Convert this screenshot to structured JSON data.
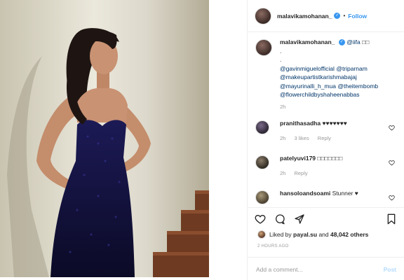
{
  "post": {
    "username": "malavikamohanan_",
    "follow_label": "Follow",
    "separator": "•",
    "verified_glyph": "✓"
  },
  "caption": {
    "username": "malavikamohanan_",
    "first_line_mention": "@iifa",
    "first_line_tail": "□□",
    "dot1": ".",
    "dot2": ".",
    "mention1": "@gavinmiguelofficial",
    "mention2": "@triparnam",
    "mention3": "@makeupartistkarishmabajaj",
    "mention4": "@mayurinalli_h_mua",
    "mention5": "@theitembomb",
    "mention6": "@flowerchildbyshaheenabbas",
    "time": "2h"
  },
  "comments": [
    {
      "username": "pranithasadha",
      "text": "♥♥♥♥♥♥♥",
      "time": "2h",
      "likes": "3 likes",
      "reply": "Reply"
    },
    {
      "username": "patelyuvi179",
      "text": "□□□□□□□",
      "time": "2h",
      "reply": "Reply"
    },
    {
      "username": "hansoloandsoami",
      "text": "Stunner ♥"
    }
  ],
  "likes": {
    "prefix": "Liked by",
    "user": "payal.su",
    "and": "and",
    "count": "48,042 others"
  },
  "timestamp": "2 HOURS AGO",
  "add_comment": {
    "placeholder": "Add a comment...",
    "post_label": "Post"
  },
  "colors": {
    "link": "#3897f0",
    "mention": "#003569",
    "muted": "#999999",
    "text": "#262626"
  }
}
